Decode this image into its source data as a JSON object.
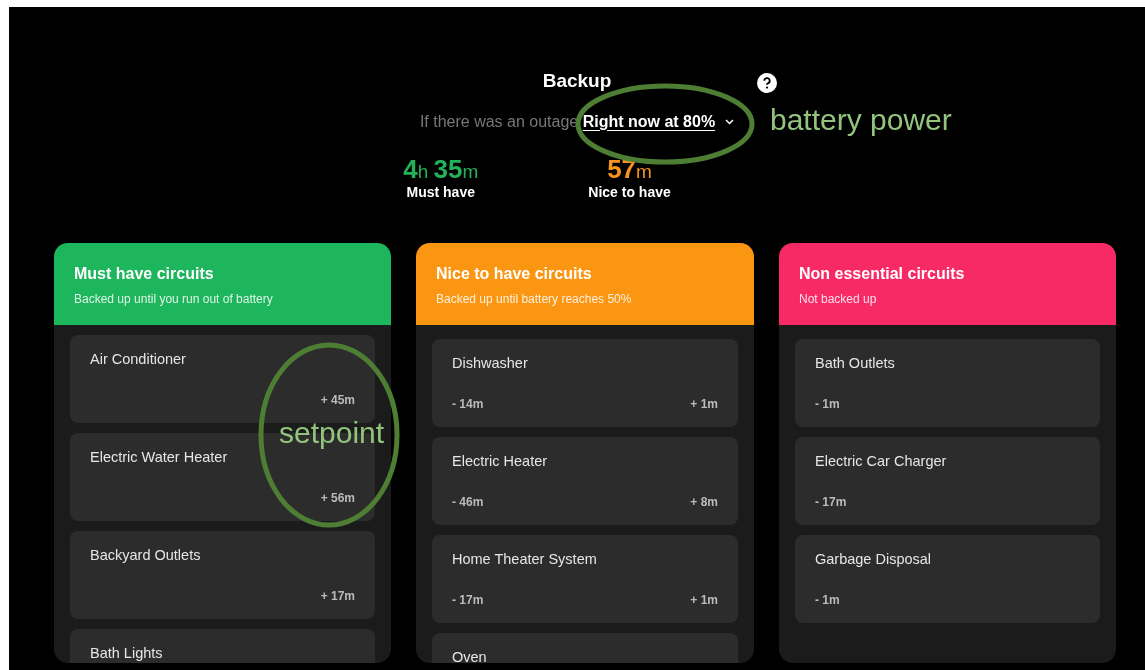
{
  "title": "Backup",
  "subtitle": {
    "prefix": "If there was an outage",
    "selector": "Right now at 80%"
  },
  "stats": [
    {
      "value": "4h 35m",
      "label": "Must have",
      "color": "#22b35a"
    },
    {
      "value": "57m",
      "label": "Nice to have",
      "color": "#f7931e"
    }
  ],
  "groups": [
    {
      "title": "Must have circuits",
      "subtitle": "Backed up until you run out of battery",
      "color": "#1db65c",
      "circuits": [
        {
          "name": "Air Conditioner",
          "plus": "+ 45m"
        },
        {
          "name": "Electric Water Heater",
          "plus": "+ 56m"
        },
        {
          "name": "Backyard Outlets",
          "plus": "+ 17m"
        },
        {
          "name": "Bath Lights"
        }
      ]
    },
    {
      "title": "Nice to have circuits",
      "subtitle": "Backed up until battery reaches 50%",
      "color": "#fb9613",
      "circuits": [
        {
          "name": "Dishwasher",
          "minus": "- 14m",
          "plus": "+ 1m"
        },
        {
          "name": "Electric Heater",
          "minus": "- 46m",
          "plus": "+ 8m"
        },
        {
          "name": "Home Theater System",
          "minus": "- 17m",
          "plus": "+ 1m"
        },
        {
          "name": "Oven"
        }
      ]
    },
    {
      "title": "Non essential circuits",
      "subtitle": "Not backed up",
      "color": "#f72a65",
      "circuits": [
        {
          "name": "Bath Outlets",
          "minus": "- 1m"
        },
        {
          "name": "Electric Car Charger",
          "minus": "- 17m"
        },
        {
          "name": "Garbage Disposal",
          "minus": "- 1m"
        }
      ]
    }
  ],
  "annotations": [
    {
      "label": "battery power"
    },
    {
      "label": "setpoint"
    }
  ]
}
